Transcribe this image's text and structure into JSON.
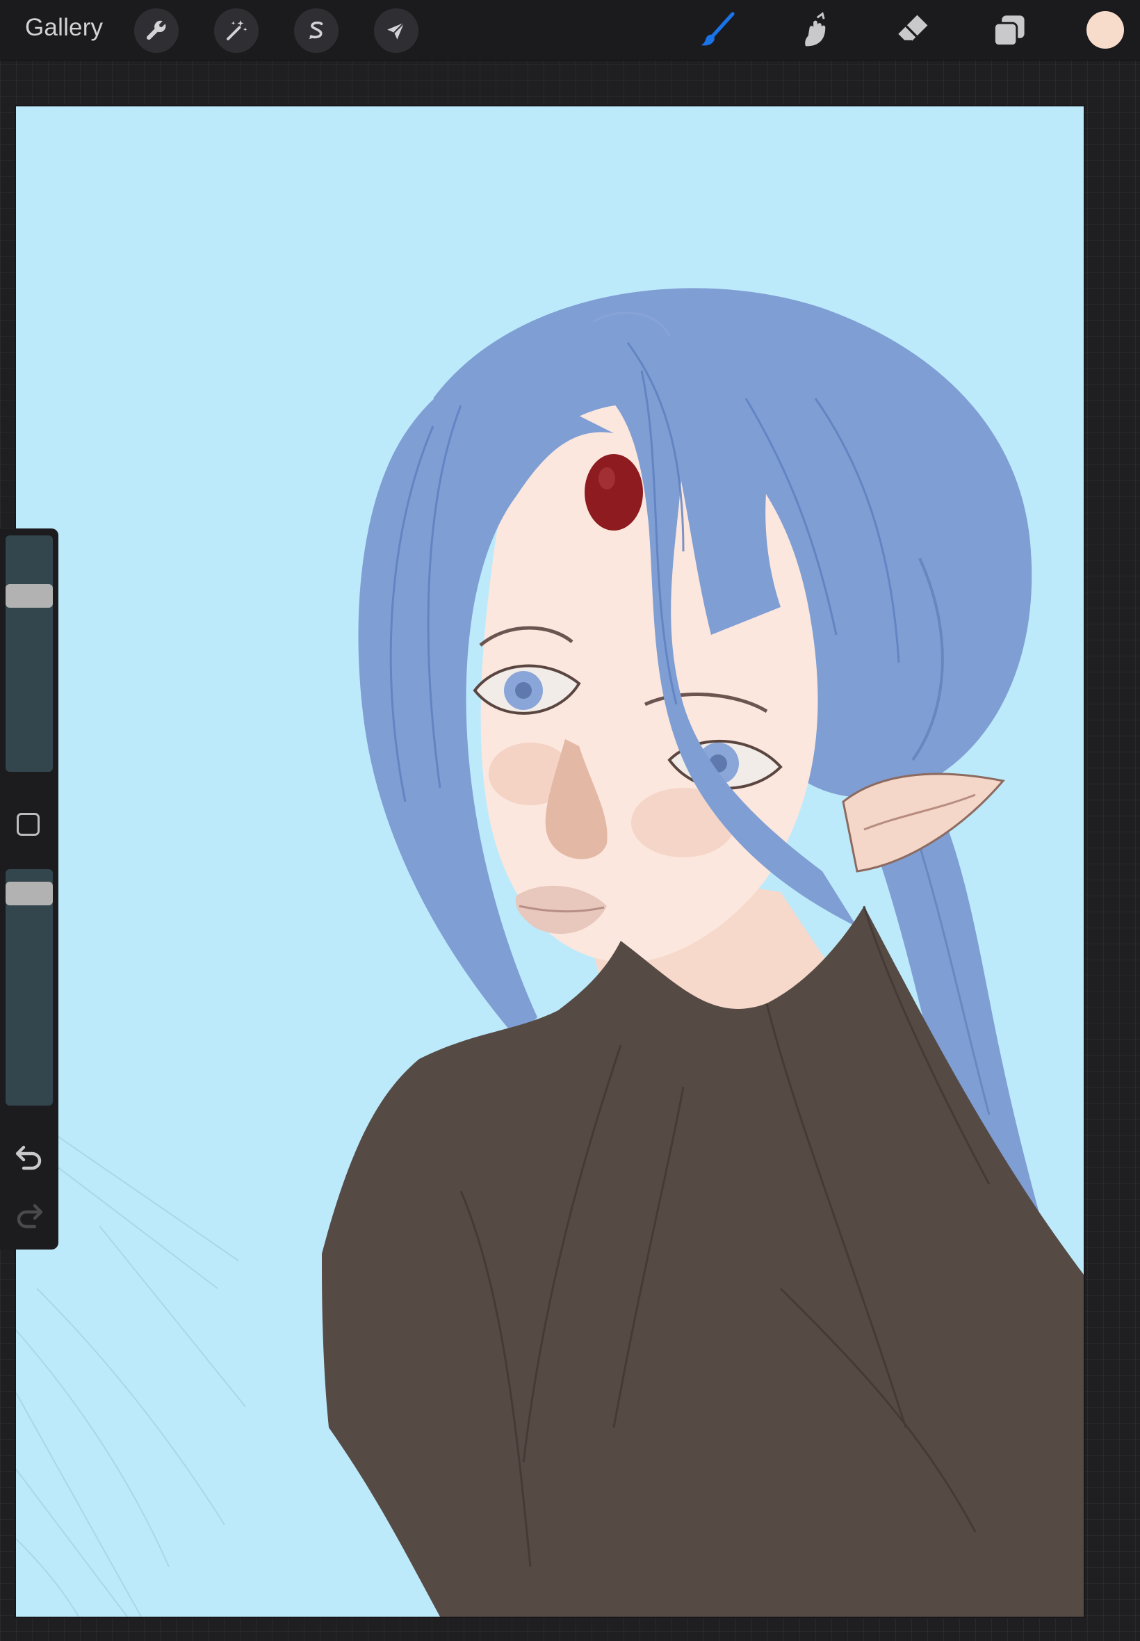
{
  "topbar": {
    "gallery_label": "Gallery",
    "left_tools": [
      {
        "name": "actions",
        "icon": "wrench-icon"
      },
      {
        "name": "adjustments",
        "icon": "magic-wand-icon"
      },
      {
        "name": "selection",
        "icon": "selection-s-icon"
      },
      {
        "name": "transform",
        "icon": "arrow-cursor-icon"
      }
    ],
    "right_tools": [
      {
        "name": "brush",
        "icon": "brush-icon",
        "active": true
      },
      {
        "name": "smudge",
        "icon": "smudge-finger-icon",
        "active": false
      },
      {
        "name": "eraser",
        "icon": "eraser-icon",
        "active": false
      },
      {
        "name": "layers",
        "icon": "layers-icon",
        "active": false
      }
    ],
    "current_color": "#f8dccb"
  },
  "sidebar": {
    "brush_size_level": 0.77,
    "brush_opacity_level": 0.94,
    "modifier_icon": "square-modifier-icon",
    "undo_icon": "undo-icon",
    "redo_icon": "redo-icon",
    "redo_enabled": false
  },
  "canvas": {
    "background_color": "#bdeafb",
    "artwork_icon": "elf-portrait-illustration"
  },
  "colors": {
    "accent": "#1a73e8",
    "hair": "#7f9ed4",
    "skin": "#fbe7de",
    "clothing": "#564a45",
    "gem": "#8e1b1f"
  }
}
